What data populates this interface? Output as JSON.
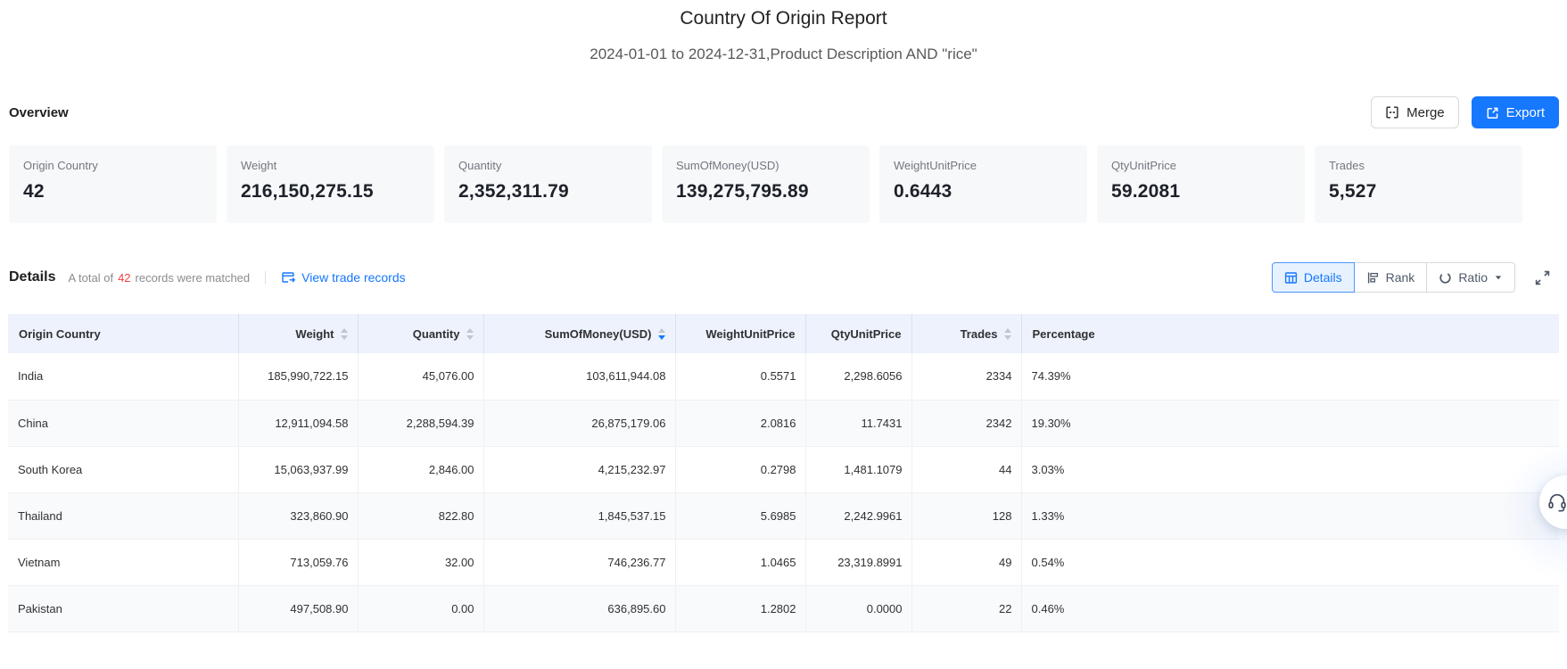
{
  "report": {
    "title": "Country Of Origin Report",
    "subtitle": "2024-01-01 to 2024-12-31,Product Description AND \"rice\""
  },
  "overview": {
    "heading": "Overview",
    "merge_label": "Merge",
    "export_label": "Export",
    "cards": [
      {
        "label": "Origin Country",
        "value": "42"
      },
      {
        "label": "Weight",
        "value": "216,150,275.15"
      },
      {
        "label": "Quantity",
        "value": "2,352,311.79"
      },
      {
        "label": "SumOfMoney(USD)",
        "value": "139,275,795.89"
      },
      {
        "label": "WeightUnitPrice",
        "value": "0.6443"
      },
      {
        "label": "QtyUnitPrice",
        "value": "59.2081"
      },
      {
        "label": "Trades",
        "value": "5,527"
      }
    ]
  },
  "details": {
    "heading": "Details",
    "summary_prefix": "A total of",
    "summary_count": "42",
    "summary_suffix": "records were matched",
    "view_link": "View trade records",
    "tabs": [
      {
        "label": "Details",
        "active": true
      },
      {
        "label": "Rank",
        "active": false
      },
      {
        "label": "Ratio",
        "active": false,
        "has_dropdown": true
      }
    ],
    "icons": [
      "table-icon",
      "rank-bars-icon",
      "ratio-donut-icon",
      "fullscreen-icon",
      "headset-icon"
    ],
    "accent_color": "#1677ff",
    "count_color": "#f53f3f"
  },
  "table": {
    "columns": [
      {
        "label": "Origin Country",
        "sortable": false,
        "align": "left"
      },
      {
        "label": "Weight",
        "sortable": true,
        "align": "right",
        "sort": "none"
      },
      {
        "label": "Quantity",
        "sortable": true,
        "align": "right",
        "sort": "none"
      },
      {
        "label": "SumOfMoney(USD)",
        "sortable": true,
        "align": "right",
        "sort": "desc"
      },
      {
        "label": "WeightUnitPrice",
        "sortable": false,
        "align": "right"
      },
      {
        "label": "QtyUnitPrice",
        "sortable": false,
        "align": "right"
      },
      {
        "label": "Trades",
        "sortable": true,
        "align": "right",
        "sort": "none"
      },
      {
        "label": "Percentage",
        "sortable": false,
        "align": "left"
      }
    ],
    "rows": [
      [
        "India",
        "185,990,722.15",
        "45,076.00",
        "103,611,944.08",
        "0.5571",
        "2,298.6056",
        "2334",
        "74.39%"
      ],
      [
        "China",
        "12,911,094.58",
        "2,288,594.39",
        "26,875,179.06",
        "2.0816",
        "11.7431",
        "2342",
        "19.30%"
      ],
      [
        "South Korea",
        "15,063,937.99",
        "2,846.00",
        "4,215,232.97",
        "0.2798",
        "1,481.1079",
        "44",
        "3.03%"
      ],
      [
        "Thailand",
        "323,860.90",
        "822.80",
        "1,845,537.15",
        "5.6985",
        "2,242.9961",
        "128",
        "1.33%"
      ],
      [
        "Vietnam",
        "713,059.76",
        "32.00",
        "746,236.77",
        "1.0465",
        "23,319.8991",
        "49",
        "0.54%"
      ],
      [
        "Pakistan",
        "497,508.90",
        "0.00",
        "636,895.60",
        "1.2802",
        "0.0000",
        "22",
        "0.46%"
      ]
    ]
  }
}
